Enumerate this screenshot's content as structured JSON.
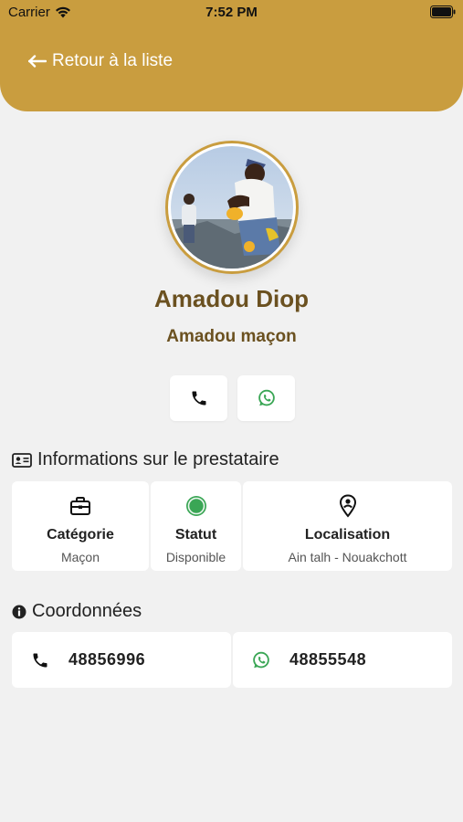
{
  "status_bar": {
    "carrier": "Carrier",
    "time": "7:52 PM"
  },
  "header": {
    "back_label": "Retour à la liste",
    "background_color": "#c99d3f"
  },
  "profile": {
    "name": "Amadou Diop",
    "subtitle": "Amadou maçon",
    "name_color": "#6b5120"
  },
  "actions": [
    {
      "icon": "phone-icon"
    },
    {
      "icon": "whatsapp-icon",
      "color": "#3aa655"
    }
  ],
  "info_section": {
    "title": "Informations sur le prestataire",
    "icon": "id-card-icon",
    "cards": [
      {
        "icon": "briefcase-icon",
        "label": "Catégorie",
        "value": "Maçon"
      },
      {
        "icon": "status-dot-icon",
        "label": "Statut",
        "value": "Disponible",
        "status_color": "#3aa655"
      },
      {
        "icon": "location-pin-icon",
        "label": "Localisation",
        "value": "Ain talh - Nouakchott"
      }
    ]
  },
  "contact_section": {
    "title": "Coordonnées",
    "icon": "info-circle-icon",
    "items": [
      {
        "icon": "phone-icon",
        "value": "48856996"
      },
      {
        "icon": "whatsapp-icon",
        "value": "48855548"
      }
    ]
  }
}
